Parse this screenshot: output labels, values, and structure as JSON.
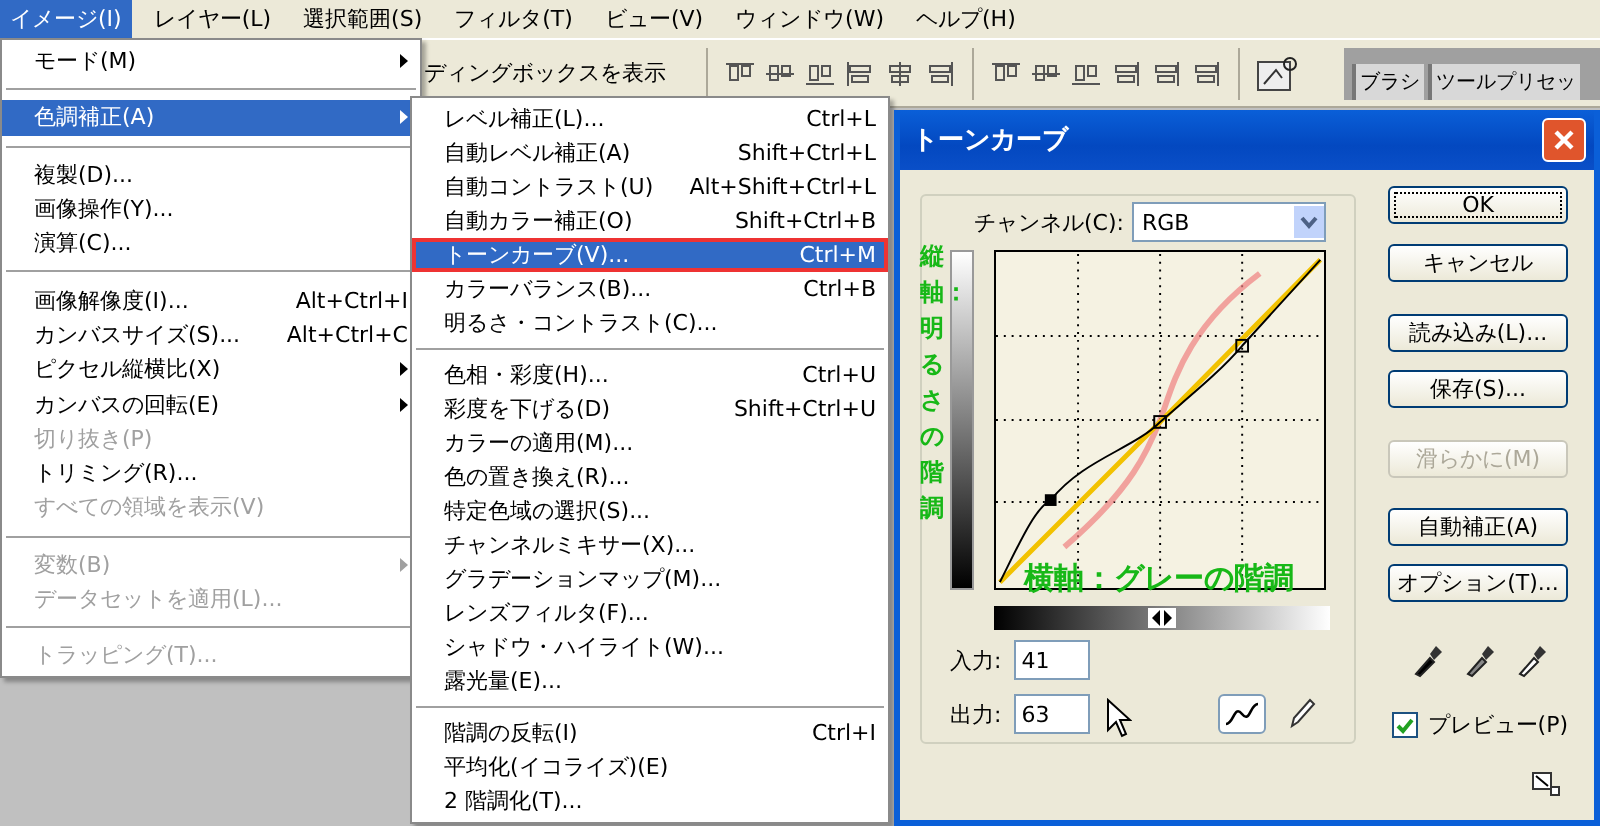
{
  "menubar": [
    {
      "label": "イメージ(I)",
      "selected": true
    },
    {
      "label": "レイヤー(L)",
      "selected": false
    },
    {
      "label": "選択範囲(S)",
      "selected": false
    },
    {
      "label": "フィルタ(T)",
      "selected": false
    },
    {
      "label": "ビュー(V)",
      "selected": false
    },
    {
      "label": "ウィンドウ(W)",
      "selected": false
    },
    {
      "label": "ヘルプ(H)",
      "selected": false
    }
  ],
  "toolbar": {
    "text": "ディングボックスを表示",
    "palette_tabs": [
      "ブラシ",
      "ツールプリセッ"
    ]
  },
  "image_menu": {
    "items": [
      {
        "kind": "item",
        "label": "モード(M)",
        "submenu": true,
        "disabled": false,
        "selected": false
      },
      {
        "kind": "separator"
      },
      {
        "kind": "item",
        "label": "色調補正(A)",
        "submenu": true,
        "disabled": false,
        "selected": true
      },
      {
        "kind": "separator"
      },
      {
        "kind": "item",
        "label": "複製(D)...",
        "submenu": false,
        "disabled": false,
        "selected": false
      },
      {
        "kind": "item",
        "label": "画像操作(Y)...",
        "submenu": false,
        "disabled": false,
        "selected": false
      },
      {
        "kind": "item",
        "label": "演算(C)...",
        "submenu": false,
        "disabled": false,
        "selected": false
      },
      {
        "kind": "separator"
      },
      {
        "kind": "item",
        "label": "画像解像度(I)...",
        "shortcut": "Alt+Ctrl+I",
        "submenu": false,
        "disabled": false,
        "selected": false
      },
      {
        "kind": "item",
        "label": "カンバスサイズ(S)...",
        "shortcut": "Alt+Ctrl+C",
        "submenu": false,
        "disabled": false,
        "selected": false
      },
      {
        "kind": "item",
        "label": "ピクセル縦横比(X)",
        "submenu": true,
        "disabled": false,
        "selected": false
      },
      {
        "kind": "item",
        "label": "カンバスの回転(E)",
        "submenu": true,
        "disabled": false,
        "selected": false
      },
      {
        "kind": "item",
        "label": "切り抜き(P)",
        "submenu": false,
        "disabled": true,
        "selected": false
      },
      {
        "kind": "item",
        "label": "トリミング(R)...",
        "submenu": false,
        "disabled": false,
        "selected": false
      },
      {
        "kind": "item",
        "label": "すべての領域を表示(V)",
        "submenu": false,
        "disabled": true,
        "selected": false
      },
      {
        "kind": "separator"
      },
      {
        "kind": "item",
        "label": "変数(B)",
        "submenu": true,
        "disabled": true,
        "selected": false
      },
      {
        "kind": "item",
        "label": "データセットを適用(L)...",
        "submenu": false,
        "disabled": true,
        "selected": false
      },
      {
        "kind": "separator"
      },
      {
        "kind": "item",
        "label": "トラッピング(T)...",
        "submenu": false,
        "disabled": true,
        "selected": false
      }
    ]
  },
  "adjust_menu": {
    "items": [
      {
        "kind": "item",
        "label": "レベル補正(L)...",
        "shortcut": "Ctrl+L",
        "selected": false,
        "marked": false
      },
      {
        "kind": "item",
        "label": "自動レベル補正(A)",
        "shortcut": "Shift+Ctrl+L",
        "selected": false,
        "marked": false
      },
      {
        "kind": "item",
        "label": "自動コントラスト(U)",
        "shortcut": "Alt+Shift+Ctrl+L",
        "selected": false,
        "marked": false
      },
      {
        "kind": "item",
        "label": "自動カラー補正(O)",
        "shortcut": "Shift+Ctrl+B",
        "selected": false,
        "marked": false
      },
      {
        "kind": "item",
        "label": "トーンカーブ(V)...",
        "shortcut": "Ctrl+M",
        "selected": true,
        "marked": true
      },
      {
        "kind": "item",
        "label": "カラーバランス(B)...",
        "shortcut": "Ctrl+B",
        "selected": false,
        "marked": false
      },
      {
        "kind": "item",
        "label": "明るさ・コントラスト(C)...",
        "selected": false,
        "marked": false
      },
      {
        "kind": "separator"
      },
      {
        "kind": "item",
        "label": "色相・彩度(H)...",
        "shortcut": "Ctrl+U",
        "selected": false,
        "marked": false
      },
      {
        "kind": "item",
        "label": "彩度を下げる(D)",
        "shortcut": "Shift+Ctrl+U",
        "selected": false,
        "marked": false
      },
      {
        "kind": "item",
        "label": "カラーの適用(M)...",
        "selected": false,
        "marked": false
      },
      {
        "kind": "item",
        "label": "色の置き換え(R)...",
        "selected": false,
        "marked": false
      },
      {
        "kind": "item",
        "label": "特定色域の選択(S)...",
        "selected": false,
        "marked": false
      },
      {
        "kind": "item",
        "label": "チャンネルミキサー(X)...",
        "selected": false,
        "marked": false
      },
      {
        "kind": "item",
        "label": "グラデーションマップ(M)...",
        "selected": false,
        "marked": false
      },
      {
        "kind": "item",
        "label": "レンズフィルタ(F)...",
        "selected": false,
        "marked": false
      },
      {
        "kind": "item",
        "label": "シャドウ・ハイライト(W)...",
        "selected": false,
        "marked": false
      },
      {
        "kind": "item",
        "label": "露光量(E)...",
        "selected": false,
        "marked": false
      },
      {
        "kind": "separator"
      },
      {
        "kind": "item",
        "label": "階調の反転(I)",
        "shortcut": "Ctrl+I",
        "selected": false,
        "marked": false
      },
      {
        "kind": "item",
        "label": "平均化(イコライズ)(E)",
        "selected": false,
        "marked": false
      },
      {
        "kind": "item",
        "label": "2 階調化(T)...",
        "selected": false,
        "marked": false
      }
    ]
  },
  "dialog": {
    "title": "トーンカーブ",
    "channel_label": "チャンネル(C):",
    "channel": "RGB",
    "buttons": [
      {
        "label": "OK",
        "default": true,
        "disabled": false
      },
      {
        "label": "キャンセル",
        "default": false,
        "disabled": false
      },
      {
        "label": "読み込み(L)...",
        "default": false,
        "disabled": false
      },
      {
        "label": "保存(S)...",
        "default": false,
        "disabled": false
      },
      {
        "label": "滑らかに(M)",
        "default": false,
        "disabled": true
      },
      {
        "label": "自動補正(A)",
        "default": false,
        "disabled": false
      },
      {
        "label": "オプション(T)...",
        "default": false,
        "disabled": false
      }
    ],
    "input_label": "入力:",
    "input_value": "41",
    "output_label": "出力:",
    "output_value": "63",
    "tools": [
      {
        "kind": "curve",
        "selected": true
      },
      {
        "kind": "pencil",
        "selected": false
      }
    ],
    "preview": {
      "label": "プレビュー(P)",
      "checked": true
    },
    "annotations": {
      "vertical": "縦軸：明るさの階調",
      "horizontal": "横軸：グレーの階調"
    }
  }
}
